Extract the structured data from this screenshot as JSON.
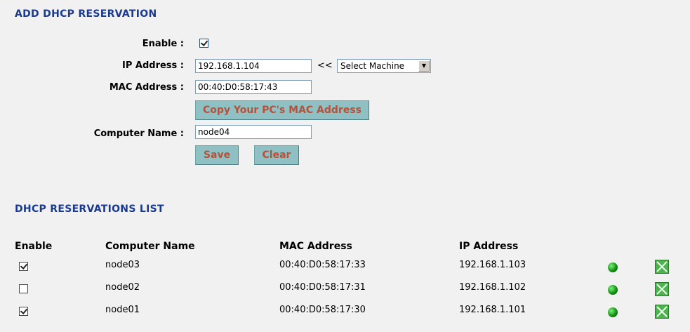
{
  "add_section": {
    "title": "ADD DHCP RESERVATION",
    "enable_label": "Enable :",
    "enable_checked": true,
    "ip_label": "IP Address :",
    "ip_value": "192.168.1.104",
    "arrows": "<<",
    "select_value": "Select Machine",
    "mac_label": "MAC Address :",
    "mac_value": "00:40:D0:58:17:43",
    "copy_button": "Copy Your PC's MAC Address",
    "name_label": "Computer Name :",
    "name_value": "node04",
    "save_button": "Save",
    "clear_button": "Clear"
  },
  "list_section": {
    "title": "DHCP RESERVATIONS LIST",
    "headers": {
      "enable": "Enable",
      "computer_name": "Computer Name",
      "mac": "MAC Address",
      "ip": "IP Address"
    },
    "rows": [
      {
        "enabled": true,
        "name": "node03",
        "mac": "00:40:D0:58:17:33",
        "ip": "192.168.1.103"
      },
      {
        "enabled": false,
        "name": "node02",
        "mac": "00:40:D0:58:17:31",
        "ip": "192.168.1.102"
      },
      {
        "enabled": true,
        "name": "node01",
        "mac": "00:40:D0:58:17:30",
        "ip": "192.168.1.101"
      }
    ]
  },
  "colors": {
    "title": "#1a3a8f",
    "button_bg": "#8fc0c4",
    "button_text": "#b4523c",
    "status_dot": "#0a8a0a",
    "delete_icon": "#4fb14f"
  },
  "icons": {
    "status": "green-dot-icon",
    "delete": "delete-x-icon",
    "select_arrow": "chevron-down-icon"
  }
}
